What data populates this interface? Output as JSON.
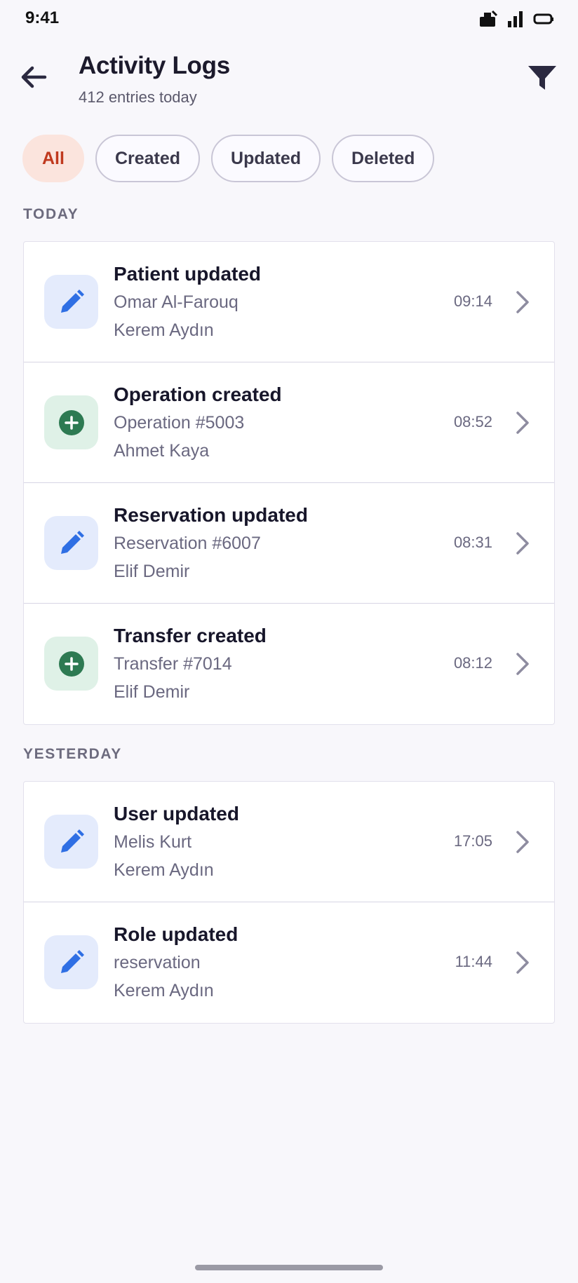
{
  "status_bar": {
    "time": "9:41",
    "icons": [
      "notification-icon",
      "signal-icon",
      "battery-icon"
    ]
  },
  "header": {
    "title": "Activity Logs",
    "subtitle": "412 entries today",
    "back_icon": "arrow-left-icon",
    "filter_icon": "filter-icon"
  },
  "filters": {
    "chips": [
      {
        "label": "All",
        "active": true
      },
      {
        "label": "Created",
        "active": false
      },
      {
        "label": "Updated",
        "active": false
      },
      {
        "label": "Deleted",
        "active": false
      }
    ]
  },
  "colors": {
    "accent_active_bg": "#fbe4dd",
    "accent_active_text": "#c0391e",
    "edit_icon": "#2f6fe4",
    "create_icon": "#2d7a52",
    "title": "#1c1a2c"
  },
  "sections": [
    {
      "label": "TODAY",
      "entries": [
        {
          "type": "edit",
          "icon": "pencil-icon",
          "title": "Patient updated",
          "subject": "Omar Al-Farouq",
          "user": "Kerem Aydın",
          "time": "09:14"
        },
        {
          "type": "create",
          "icon": "plus-circle-icon",
          "title": "Operation created",
          "subject": "Operation #5003",
          "user": "Ahmet Kaya",
          "time": "08:52"
        },
        {
          "type": "edit",
          "icon": "pencil-icon",
          "title": "Reservation updated",
          "subject": "Reservation #6007",
          "user": "Elif Demir",
          "time": "08:31"
        },
        {
          "type": "create",
          "icon": "plus-circle-icon",
          "title": "Transfer created",
          "subject": "Transfer #7014",
          "user": "Elif Demir",
          "time": "08:12"
        }
      ]
    },
    {
      "label": "YESTERDAY",
      "entries": [
        {
          "type": "edit",
          "icon": "pencil-icon",
          "title": "User updated",
          "subject": "Melis Kurt",
          "user": "Kerem Aydın",
          "time": "17:05"
        },
        {
          "type": "edit",
          "icon": "pencil-icon",
          "title": "Role updated",
          "subject": "reservation",
          "user": "Kerem Aydın",
          "time": "11:44"
        }
      ]
    }
  ]
}
